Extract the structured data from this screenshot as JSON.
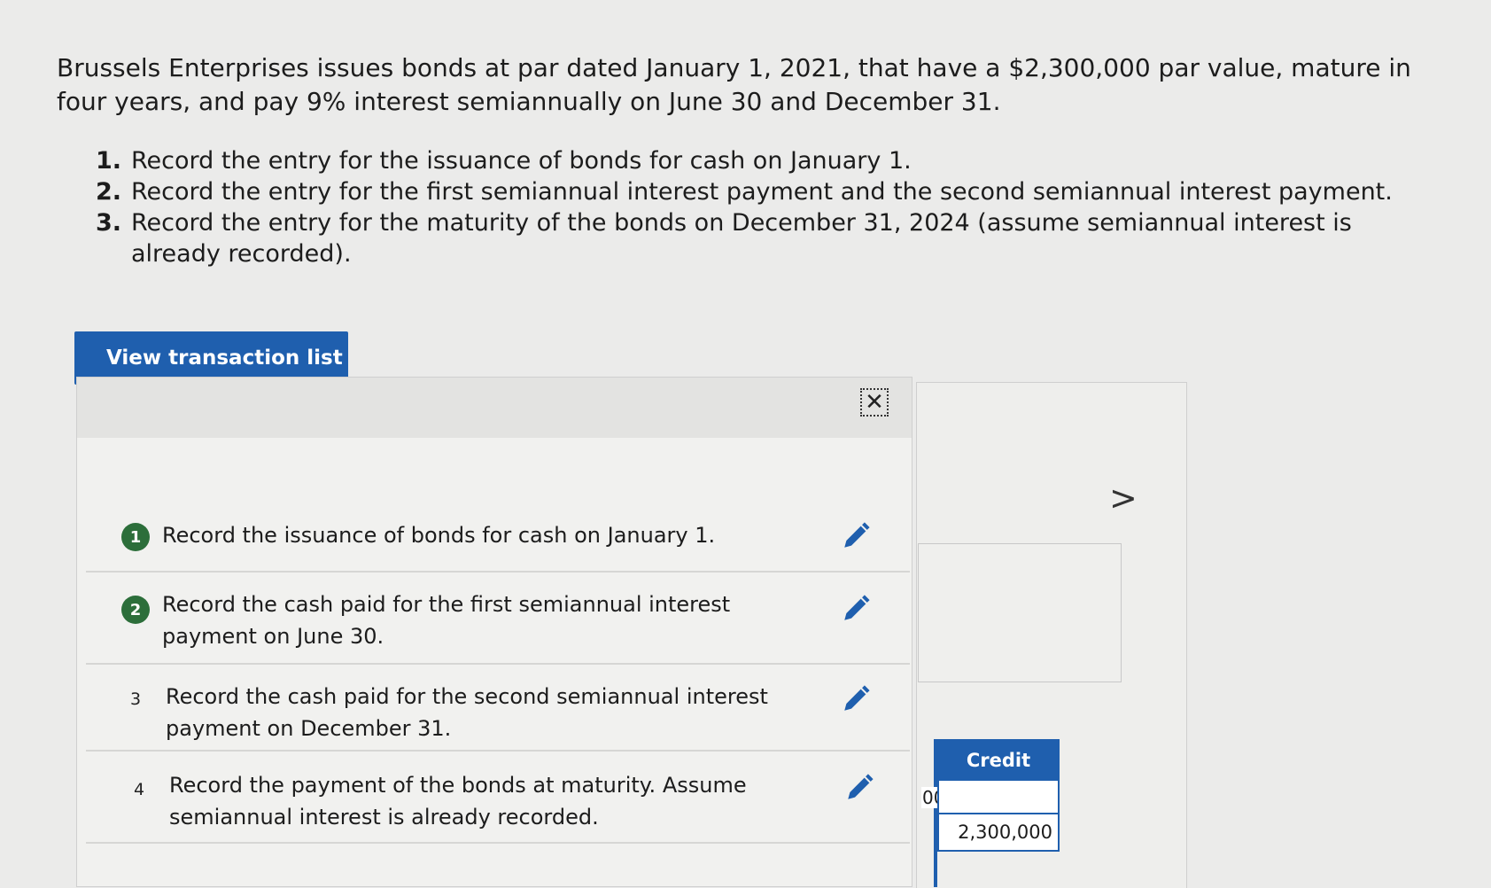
{
  "problem": {
    "intro": "Brussels Enterprises issues bonds at par dated January 1, 2021, that have a $2,300,000 par value, mature in four years, and pay 9% interest semiannually on June 30 and December 31.",
    "steps": [
      {
        "num": "1.",
        "text": "Record the entry for the issuance of bonds for cash on January 1."
      },
      {
        "num": "2.",
        "text": "Record the entry for the first semiannual interest payment and the second semiannual interest payment."
      },
      {
        "num": "3.",
        "text": "Record the entry for the maturity of the bonds on December 31, 2024 (assume semiannual interest is already recorded)."
      }
    ]
  },
  "view_button": {
    "label": "View transaction list"
  },
  "popup": {
    "close_symbol": "✕",
    "items": [
      {
        "num": "1",
        "text": "Record the issuance of bonds for cash on January 1.",
        "completed": true
      },
      {
        "num": "2",
        "text": "Record the cash paid for the first semiannual interest payment on June 30.",
        "completed": true
      },
      {
        "num": "3",
        "text": "Record the cash paid for the second semiannual interest payment on December 31.",
        "completed": false
      },
      {
        "num": "4",
        "text": "Record the payment of the bonds at maturity. Assume semiannual interest is already recorded.",
        "completed": false
      }
    ]
  },
  "background_table": {
    "credit_header": "Credit",
    "partial_value": "00",
    "credit_value": "2,300,000",
    "next_symbol": ">"
  },
  "colors": {
    "accent": "#1f5fae",
    "badge": "#2c6e3a"
  },
  "icons": {
    "edit": "pencil-icon",
    "close": "close-icon",
    "next": "chevron-right-icon"
  }
}
